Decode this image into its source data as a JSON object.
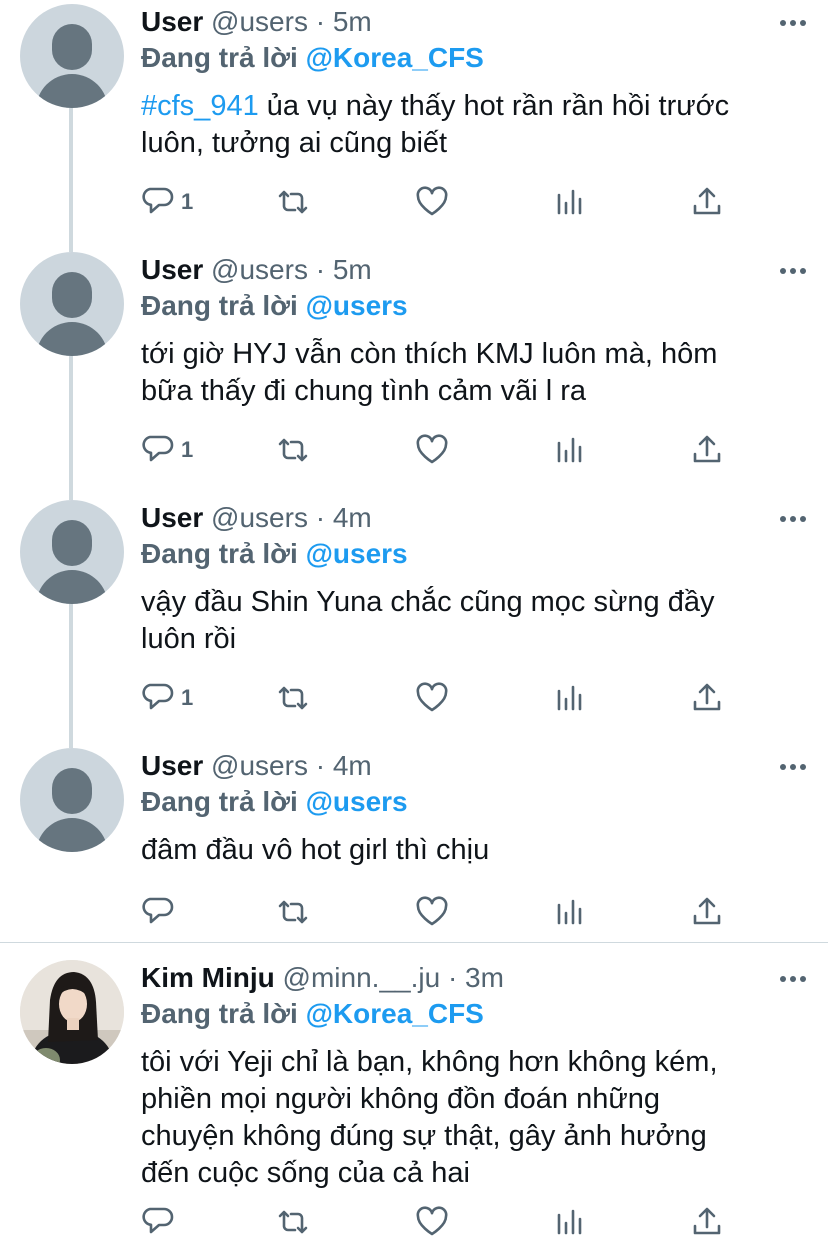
{
  "tweets": [
    {
      "name": "User",
      "handle": "@users",
      "sep": "·",
      "time": "5m",
      "reply_prefix": "Đang trả lời",
      "reply_to": "@Korea_CFS",
      "hashtag": "#cfs_941",
      "text": " ủa vụ này thấy hot rần rần hồi trước\nluôn, tưởng ai cũng biết",
      "reply_count": "1"
    },
    {
      "name": "User",
      "handle": "@users",
      "sep": "·",
      "time": "5m",
      "reply_prefix": "Đang trả lời",
      "reply_to": "@users",
      "text": "tới giờ HYJ vẫn còn thích KMJ luôn mà, hôm\nbữa thấy đi chung tình cảm vãi l ra",
      "reply_count": "1"
    },
    {
      "name": "User",
      "handle": "@users",
      "sep": "·",
      "time": "4m",
      "reply_prefix": "Đang trả lời",
      "reply_to": "@users",
      "text": "vậy đầu Shin Yuna chắc cũng mọc sừng đầy\nluôn rồi",
      "reply_count": "1"
    },
    {
      "name": "User",
      "handle": "@users",
      "sep": "·",
      "time": "4m",
      "reply_prefix": "Đang trả lời",
      "reply_to": "@users",
      "text": "đâm đầu vô hot girl thì chịu",
      "reply_count": ""
    },
    {
      "name": "Kim Minju",
      "handle": "@minn.__.ju",
      "sep": "·",
      "time": "3m",
      "reply_prefix": "Đang trả lời",
      "reply_to": "@Korea_CFS",
      "text": "tôi với Yeji chỉ là bạn, không hơn không kém,\nphiền mọi người không đồn đoán những\nchuyện không đúng sự thật, gây ảnh hưởng\nđến cuộc sống của cả hai",
      "reply_count": ""
    }
  ],
  "colors": {
    "accent": "#1d9bf0",
    "muted": "#536471",
    "text": "#0f1419",
    "line": "#cfd9de"
  },
  "icons": [
    "reply-icon",
    "retweet-icon",
    "like-icon",
    "analytics-icon",
    "share-icon",
    "more-icon"
  ]
}
